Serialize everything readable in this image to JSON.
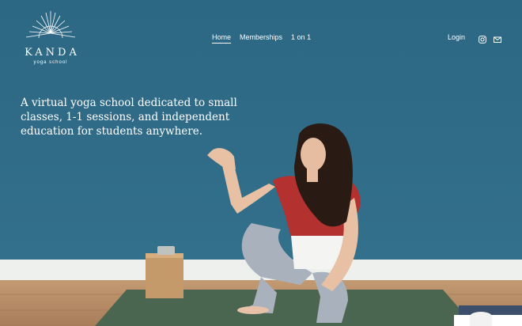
{
  "brand": {
    "name": "KANDA",
    "subtitle": "yoga school"
  },
  "nav": {
    "items": [
      {
        "label": "Home",
        "active": true
      },
      {
        "label": "Memberships",
        "active": false
      },
      {
        "label": "1 on 1",
        "active": false
      }
    ]
  },
  "header": {
    "login_label": "Login",
    "icons": [
      "instagram-icon",
      "email-icon"
    ]
  },
  "hero": {
    "tagline": "A virtual yoga school dedicated to small classes, 1-1 sessions, and independent education for students anywhere."
  },
  "colors": {
    "wall": "#2f6a85",
    "floor": "#b58c68",
    "mat": "#4b6650",
    "text": "#ffffff"
  }
}
